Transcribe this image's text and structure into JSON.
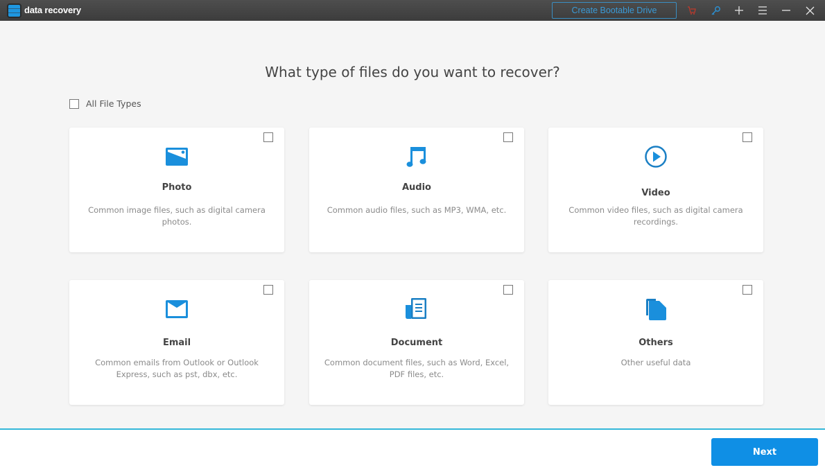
{
  "titlebar": {
    "app_title": "data recovery",
    "bootable_button": "Create Bootable Drive",
    "icons": [
      "cart-icon",
      "key-icon",
      "plus-icon",
      "menu-icon",
      "minimize-icon",
      "close-icon"
    ]
  },
  "main": {
    "heading": "What type of files do you want to recover?",
    "all_file_types": {
      "label": "All File Types",
      "checked": false
    },
    "cards": [
      {
        "title": "Photo",
        "description": "Common image files, such as digital camera photos.",
        "icon": "photo-icon",
        "checked": false
      },
      {
        "title": "Audio",
        "description": "Common audio files, such as MP3, WMA, etc.",
        "icon": "audio-icon",
        "checked": false
      },
      {
        "title": "Video",
        "description": "Common video files, such as digital camera recordings.",
        "icon": "video-icon",
        "checked": false
      },
      {
        "title": "Email",
        "description": "Common emails from Outlook or Outlook Express, such as pst, dbx, etc.",
        "icon": "email-icon",
        "checked": false
      },
      {
        "title": "Document",
        "description": "Common document files, such as Word, Excel, PDF files, etc.",
        "icon": "document-icon",
        "checked": false
      },
      {
        "title": "Others",
        "description": "Other useful data",
        "icon": "others-icon",
        "checked": false
      }
    ]
  },
  "footer": {
    "next_label": "Next"
  },
  "colors": {
    "accent": "#0f8fe5",
    "icon_blue": "#1a8fdc",
    "footer_line": "#34b7d8",
    "titlebar": "#454545"
  }
}
